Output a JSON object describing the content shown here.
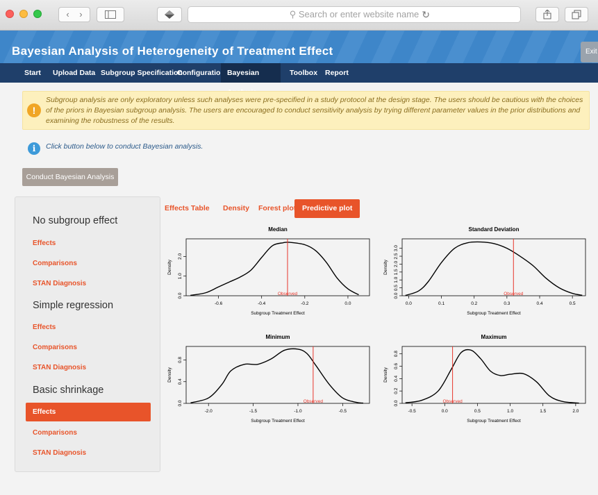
{
  "browser": {
    "address_placeholder": "Search or enter website name",
    "reload_icon": "reload-icon"
  },
  "app": {
    "title": "Bayesian Analysis of Heterogeneity of Treatment Effect",
    "exit_label": "Exit"
  },
  "nav": {
    "tabs": [
      {
        "label": "Start"
      },
      {
        "label": "Upload Data"
      },
      {
        "label": "Subgroup Specification"
      },
      {
        "label": "Configuration"
      },
      {
        "label": "Bayesian Analysis",
        "active": true
      },
      {
        "label": "Toolbox"
      },
      {
        "label": "Report"
      }
    ]
  },
  "alerts": {
    "warning": "Subgroup analysis are only exploratory unless such analyses were pre-specified in a study protocol at the design stage. The users should be cautious with the choices of the priors in Bayesian subgroup analysis. The users are encouraged to conduct sensitivity analysis by trying different parameter values in the prior distributions and examining the robustness of the results.",
    "warning_icon": "!",
    "info": "Click button below to conduct Bayesian analysis.",
    "info_icon": "i"
  },
  "run_button": "Conduct Bayesian Analysis",
  "sidebar": {
    "sections": [
      {
        "heading": "No subgroup effect",
        "links": [
          "Effects",
          "Comparisons",
          "STAN Diagnosis"
        ]
      },
      {
        "heading": "Simple regression",
        "links": [
          "Effects",
          "Comparisons",
          "STAN Diagnosis"
        ]
      },
      {
        "heading": "Basic shrinkage",
        "links": [
          "Effects",
          "Comparisons",
          "STAN Diagnosis"
        ],
        "active_link": "Effects"
      }
    ]
  },
  "content_tabs": [
    {
      "label": "Effects Table"
    },
    {
      "label": "Density"
    },
    {
      "label": "Forest plot"
    },
    {
      "label": "Predictive plot",
      "active": true
    }
  ],
  "colors": {
    "accent": "#e8542a",
    "header_blue": "#3e86c9",
    "nav_dark": "#1f3f6a",
    "observed_line": "#e8352a"
  },
  "chart_data": [
    {
      "type": "line",
      "title": "Median",
      "xlabel": "Subgroup Treatment Effect",
      "ylabel": "Density",
      "xlim": [
        -0.75,
        0.1
      ],
      "ylim": [
        0,
        2.9
      ],
      "xticks": [
        -0.6,
        -0.4,
        -0.2,
        0.0
      ],
      "xtick_labels": [
        "-0.6",
        "-0.4",
        "-0.2",
        "0.0"
      ],
      "yticks": [
        0,
        1.0,
        2.0
      ],
      "ytick_labels": [
        "0.0",
        "1.0",
        "2.0"
      ],
      "x": [
        -0.73,
        -0.66,
        -0.6,
        -0.55,
        -0.5,
        -0.45,
        -0.4,
        -0.35,
        -0.3,
        -0.27,
        -0.2,
        -0.15,
        -0.1,
        -0.05,
        0.0,
        0.05
      ],
      "y": [
        0.02,
        0.15,
        0.45,
        0.7,
        0.95,
        1.3,
        1.95,
        2.55,
        2.7,
        2.72,
        2.6,
        2.3,
        1.7,
        0.9,
        0.35,
        0.05
      ],
      "observed": -0.28,
      "observed_label": "Observed"
    },
    {
      "type": "line",
      "title": "Standard Deviation",
      "xlabel": "Subgroup Treatment Effect",
      "ylabel": "Density",
      "xlim": [
        -0.02,
        0.54
      ],
      "ylim": [
        0,
        3.6
      ],
      "xticks": [
        0.0,
        0.1,
        0.2,
        0.3,
        0.4,
        0.5
      ],
      "xtick_labels": [
        "0.0",
        "0.1",
        "0.2",
        "0.3",
        "0.4",
        "0.5"
      ],
      "yticks": [
        0,
        0.5,
        1.0,
        1.5,
        2.0,
        2.5,
        3.0
      ],
      "ytick_labels": [
        "0.0",
        "0.5",
        "1.0",
        "1.5",
        "2.0",
        "2.5",
        "3.0"
      ],
      "x": [
        -0.01,
        0.03,
        0.06,
        0.1,
        0.14,
        0.18,
        0.22,
        0.26,
        0.3,
        0.34,
        0.38,
        0.42,
        0.46,
        0.5,
        0.53
      ],
      "y": [
        0.02,
        0.3,
        0.9,
        2.1,
        3.0,
        3.35,
        3.4,
        3.3,
        3.0,
        2.5,
        1.9,
        1.1,
        0.5,
        0.15,
        0.03
      ],
      "observed": 0.32,
      "observed_label": "Observed"
    },
    {
      "type": "line",
      "title": "Minimum",
      "xlabel": "Subgroup Treatment Effect",
      "ylabel": "Density",
      "xlim": [
        -2.25,
        -0.2
      ],
      "ylim": [
        0,
        1.05
      ],
      "xticks": [
        -2.0,
        -1.5,
        -1.0,
        -0.5
      ],
      "xtick_labels": [
        "-2.0",
        "-1.5",
        "-1.0",
        "-0.5"
      ],
      "yticks": [
        0,
        0.4,
        0.8
      ],
      "ytick_labels": [
        "0.0",
        "0.4",
        "0.8"
      ],
      "x": [
        -2.2,
        -2.0,
        -1.85,
        -1.75,
        -1.6,
        -1.45,
        -1.3,
        -1.15,
        -1.0,
        -0.9,
        -0.8,
        -0.65,
        -0.5,
        -0.35,
        -0.27
      ],
      "y": [
        0.01,
        0.1,
        0.35,
        0.6,
        0.72,
        0.72,
        0.82,
        0.98,
        1.0,
        0.92,
        0.7,
        0.35,
        0.1,
        0.02,
        0.005
      ],
      "observed": -0.83,
      "observed_label": "Observed"
    },
    {
      "type": "line",
      "title": "Maximum",
      "xlabel": "Subgroup Treatment Effect",
      "ylabel": "Density",
      "xlim": [
        -0.65,
        2.15
      ],
      "ylim": [
        0,
        0.92
      ],
      "xticks": [
        -0.5,
        0.0,
        0.5,
        1.0,
        1.5,
        2.0
      ],
      "xtick_labels": [
        "-0.5",
        "0.0",
        "0.5",
        "1.0",
        "1.5",
        "2.0"
      ],
      "yticks": [
        0,
        0.2,
        0.4,
        0.6,
        0.8
      ],
      "ytick_labels": [
        "0.0",
        "0.2",
        "0.4",
        "0.6",
        "0.8"
      ],
      "x": [
        -0.6,
        -0.35,
        -0.1,
        0.1,
        0.25,
        0.4,
        0.55,
        0.7,
        0.85,
        1.0,
        1.2,
        1.4,
        1.6,
        1.8,
        2.05
      ],
      "y": [
        0.01,
        0.05,
        0.2,
        0.55,
        0.82,
        0.86,
        0.72,
        0.52,
        0.45,
        0.47,
        0.48,
        0.35,
        0.12,
        0.03,
        0.005
      ],
      "observed": 0.12,
      "observed_label": "Observed"
    }
  ]
}
